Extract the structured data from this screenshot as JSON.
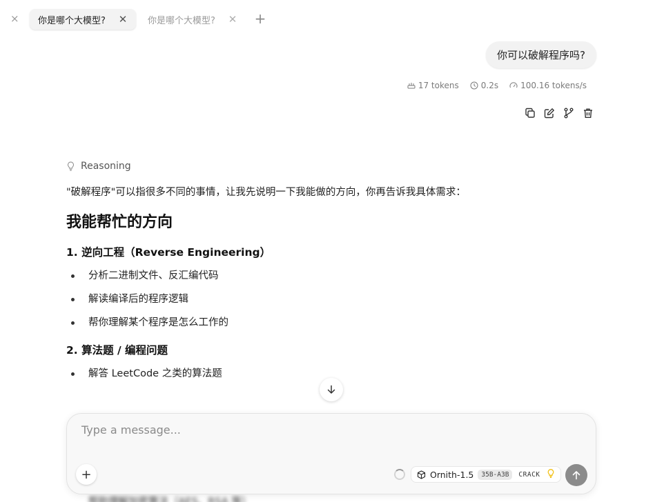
{
  "tabs": {
    "prev_close_glyph": "×",
    "items": [
      {
        "label": "你是哪个大模型?",
        "active": true,
        "close_glyph": "✕"
      },
      {
        "label": "你是哪个大模型?",
        "active": false,
        "close_glyph": "✕"
      }
    ],
    "add_glyph": "+"
  },
  "user_message": {
    "text": "你可以破解程序吗?"
  },
  "stats": {
    "tokens": "17 tokens",
    "time": "0.2s",
    "speed": "100.16 tokens/s"
  },
  "actions": {
    "copy_icon": "copy-icon",
    "edit_icon": "edit-icon",
    "branch_icon": "branch-icon",
    "delete_icon": "trash-icon"
  },
  "assistant": {
    "reasoning_label": "Reasoning",
    "intro": "\"破解程序\"可以指很多不同的事情，让我先说明一下我能做的方向，你再告诉我具体需求：",
    "heading": "我能帮忙的方向",
    "section1_title": "1. 逆向工程（Reverse Engineering）",
    "section1_items": [
      "分析二进制文件、反汇编代码",
      "解读编译后的程序逻辑",
      "帮你理解某个程序是怎么工作的"
    ],
    "section2_title": "2. 算法题 / 编程问题",
    "section2_items": [
      "解答 LeetCode 之类的算法题"
    ],
    "hidden_line_bottom": "帮助理解加密算法（AES、RSA 等）"
  },
  "composer": {
    "placeholder": "Type a message...",
    "add_glyph": "+",
    "model_name": "Ornith-1.5",
    "model_size": "35B-A3B",
    "model_tag": "CRACK"
  },
  "colors": {
    "bulb": "#f2c21b",
    "send_button": "#8b8b8b"
  }
}
